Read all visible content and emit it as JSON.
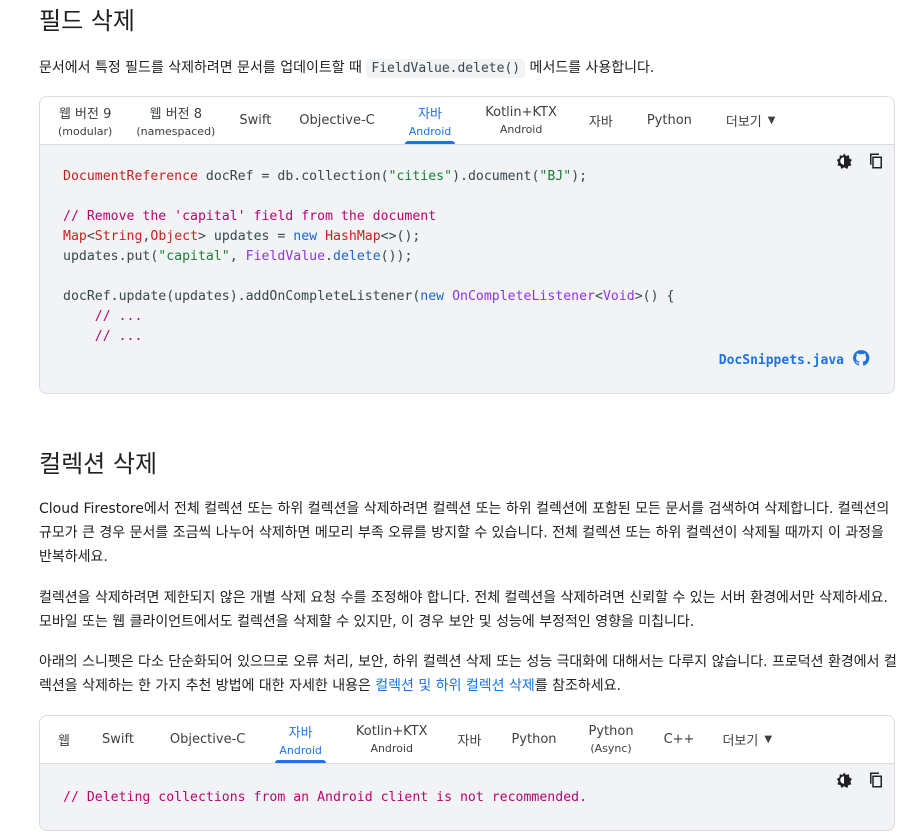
{
  "section1": {
    "title": "필드 삭제",
    "desc_before": "문서에서 특정 필드를 삭제하려면 문서를 업데이트할 때 ",
    "desc_code": "FieldValue.delete()",
    "desc_after": " 메서드를 사용합니다.",
    "tabs": [
      {
        "label": "웹 버전 9",
        "sub": "(modular)"
      },
      {
        "label": "웹 버전 8",
        "sub": "(namespaced)"
      },
      {
        "label": "Swift",
        "sub": ""
      },
      {
        "label": "Objective-C",
        "sub": ""
      },
      {
        "label": "자바",
        "sub": "Android"
      },
      {
        "label": "Kotlin+KTX",
        "sub": "Android"
      },
      {
        "label": "자바",
        "sub": ""
      },
      {
        "label": "Python",
        "sub": ""
      },
      {
        "label": "더보기",
        "sub": ""
      }
    ],
    "code": {
      "l1_type": "DocumentReference",
      "l1_rest": " docRef = db.collection(",
      "l1_s1": "\"cities\"",
      "l1_mid": ").document(",
      "l1_s2": "\"BJ\"",
      "l1_end": ");",
      "l3_comment": "// Remove the 'capital' field from the document",
      "l4_t1": "Map",
      "l4_p1": "<",
      "l4_t2": "String",
      "l4_p2": ",",
      "l4_t3": "Object",
      "l4_p3": "> updates = ",
      "l4_kw": "new",
      "l4_sp": " ",
      "l4_t4": "HashMap",
      "l4_end": "<>();",
      "l5_a": "updates.put(",
      "l5_s": "\"capital\"",
      "l5_b": ", ",
      "l5_t": "FieldValue",
      "l5_c": ".",
      "l5_k": "delete",
      "l5_d": "());",
      "l7_a": "docRef.update(updates).addOnCompleteListener(",
      "l7_kw": "new",
      "l7_sp": " ",
      "l7_t": "OnCompleteListener",
      "l7_p": "<",
      "l7_t2": "Void",
      "l7_end": ">() {",
      "l8": "    // ...",
      "l9": "    // ..."
    },
    "source_link": "DocSnippets.java"
  },
  "section2": {
    "title": "컬렉션 삭제",
    "para1": "Cloud Firestore에서 전체 컬렉션 또는 하위 컬렉션을 삭제하려면 컬렉션 또는 하위 컬렉션에 포함된 모든 문서를 검색하여 삭제합니다. 컬렉션의 규모가 큰 경우 문서를 조금씩 나누어 삭제하면 메모리 부족 오류를 방지할 수 있습니다. 전체 컬렉션 또는 하위 컬렉션이 삭제될 때까지 이 과정을 반복하세요.",
    "para2": "컬렉션을 삭제하려면 제한되지 않은 개별 삭제 요청 수를 조정해야 합니다. 전체 컬렉션을 삭제하려면 신뢰할 수 있는 서버 환경에서만 삭제하세요. 모바일 또는 웹 클라이언트에서도 컬렉션을 삭제할 수 있지만, 이 경우 보안 및 성능에 부정적인 영향을 미칩니다.",
    "para3_before": "아래의 스니펫은 다소 단순화되어 있으므로 오류 처리, 보안, 하위 컬렉션 삭제 또는 성능 극대화에 대해서는 다루지 않습니다. 프로덕션 환경에서 컬렉션을 삭제하는 한 가지 추천 방법에 대한 자세한 내용은 ",
    "para3_link": "컬렉션 및 하위 컬렉션 삭제",
    "para3_after": "를 참조하세요.",
    "tabs": [
      {
        "label": "웹",
        "sub": ""
      },
      {
        "label": "Swift",
        "sub": ""
      },
      {
        "label": "Objective-C",
        "sub": ""
      },
      {
        "label": "자바",
        "sub": "Android"
      },
      {
        "label": "Kotlin+KTX",
        "sub": "Android"
      },
      {
        "label": "자바",
        "sub": ""
      },
      {
        "label": "Python",
        "sub": ""
      },
      {
        "label": "Python",
        "sub": "(Async)"
      },
      {
        "label": "C++",
        "sub": ""
      },
      {
        "label": "더보기",
        "sub": ""
      }
    ],
    "code_comment": "// Deleting collections from an Android client is not recommended."
  },
  "icons": {
    "theme": "dark-mode-icon",
    "copy": "copy-icon",
    "github": "github-icon",
    "caret": "caret-down-icon"
  },
  "colors": {
    "accent": "#1a73e8",
    "code_bg": "#f1f3f4",
    "comment": "#b80672",
    "string": "#188038",
    "type": "#9334e6"
  }
}
